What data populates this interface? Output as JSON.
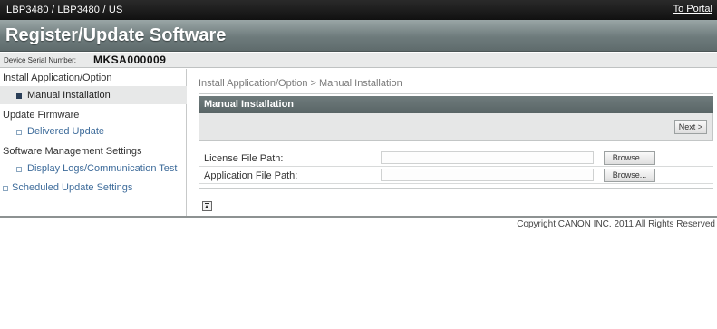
{
  "topbar": {
    "model": "LBP3480 / LBP3480 / US",
    "portal_link": "To Portal"
  },
  "header": {
    "title": "Register/Update Software"
  },
  "serial": {
    "label": "Device Serial Number:",
    "value": "MKSA000009"
  },
  "sidebar": {
    "sections": [
      {
        "label": "Install Application/Option"
      },
      {
        "label": "Manual Installation",
        "active": true
      },
      {
        "label": "Update Firmware"
      },
      {
        "label": "Delivered Update"
      },
      {
        "label": "Software Management Settings"
      },
      {
        "label": "Display Logs/Communication Test"
      },
      {
        "label": "Scheduled Update Settings"
      }
    ]
  },
  "main": {
    "breadcrumb": "Install Application/Option > Manual Installation",
    "panel_title": "Manual Installation",
    "next_label": "Next >",
    "rows": [
      {
        "label": "License File Path:",
        "value": "",
        "browse_label": "Browse..."
      },
      {
        "label": "Application File Path:",
        "value": "",
        "browse_label": "Browse..."
      }
    ]
  },
  "footer": {
    "copyright": "Copyright CANON INC. 2011 All Rights Reserved"
  },
  "colors": {
    "topbar": "#1a1a1a",
    "titlebar": "#6e7b7c",
    "link": "#3d6b9a",
    "panel_header": "#636f70"
  },
  "icons": {
    "top_button": "page-top-icon",
    "bullet": "square-bullet-icon"
  }
}
